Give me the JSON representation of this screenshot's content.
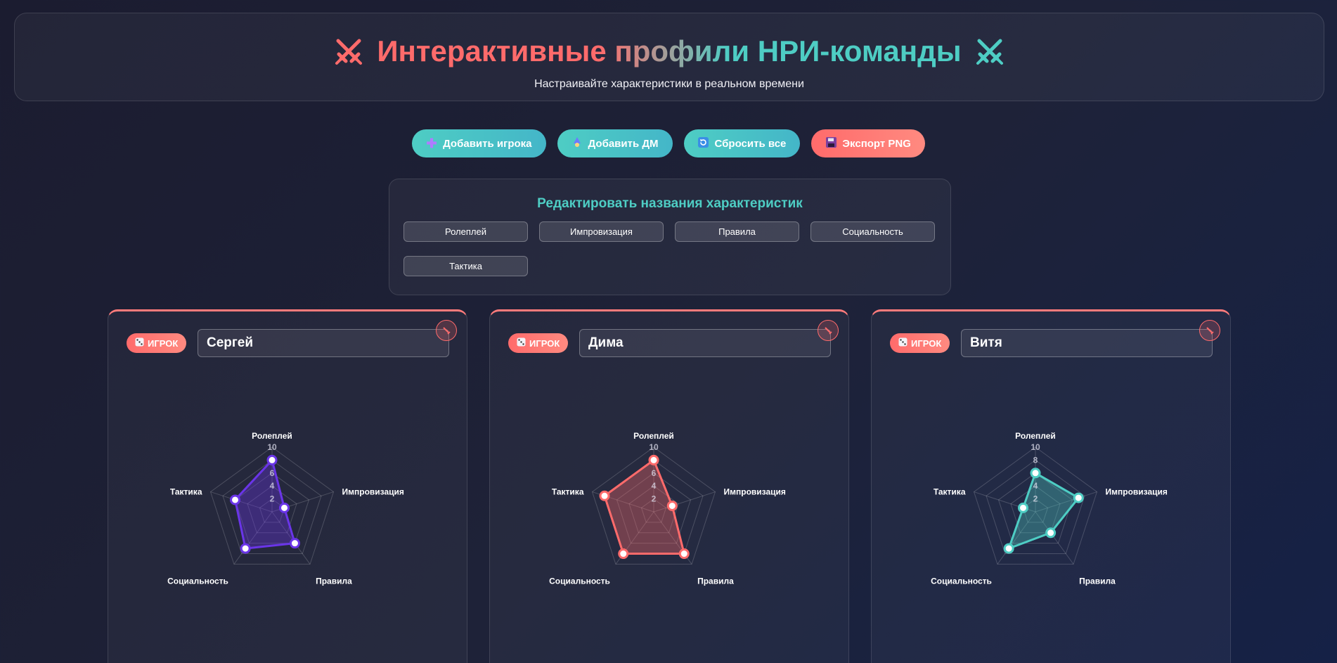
{
  "header": {
    "title": "Интерактивные профили НРИ-команды",
    "subtitle": "Настраивайте характеристики в реальном времени",
    "left_icon": "crossed-swords-icon",
    "right_icon": "crossed-swords-icon"
  },
  "toolbar": {
    "add_player": {
      "label": "Добавить игрока",
      "icon": "plus-icon"
    },
    "add_dm": {
      "label": "Добавить ДМ",
      "icon": "mage-icon"
    },
    "reset_all": {
      "label": "Сбросить все",
      "icon": "refresh-icon"
    },
    "export_png": {
      "label": "Экспорт PNG",
      "icon": "floppy-disk-icon"
    }
  },
  "stats_editor": {
    "title": "Редактировать названия характеристик",
    "stats": [
      "Ролеплей",
      "Импровизация",
      "Правила",
      "Социальность",
      "Тактика"
    ]
  },
  "cards": [
    {
      "role": "ИГРОК",
      "role_icon": "dice-icon",
      "name": "Сергей",
      "color": "#6a35e8",
      "values": [
        8,
        2,
        6,
        7,
        6
      ]
    },
    {
      "role": "ИГРОК",
      "role_icon": "dice-icon",
      "name": "Дима",
      "color": "#ff6b6b",
      "values": [
        8,
        3,
        8,
        8,
        8
      ]
    },
    {
      "role": "ИГРОК",
      "role_icon": "dice-icon",
      "name": "Витя",
      "color": "#4ecdc4",
      "values": [
        6,
        7,
        4,
        7,
        2
      ]
    }
  ],
  "chart_data": {
    "type": "radar",
    "axes": [
      "Ролеплей",
      "Импровизация",
      "Правила",
      "Социальность",
      "Тактика"
    ],
    "ticks": [
      "2",
      "4",
      "6",
      "8",
      "10"
    ],
    "range": [
      0,
      10
    ],
    "series": [
      {
        "name": "Сергей",
        "values": [
          8,
          2,
          6,
          7,
          6
        ]
      },
      {
        "name": "Дима",
        "values": [
          8,
          3,
          8,
          8,
          8
        ]
      },
      {
        "name": "Витя",
        "values": [
          6,
          7,
          4,
          7,
          2
        ]
      }
    ]
  },
  "colors": {
    "accent_red": "#ff6b6b",
    "accent_teal": "#4ecdc4",
    "purple": "#6a35e8"
  }
}
